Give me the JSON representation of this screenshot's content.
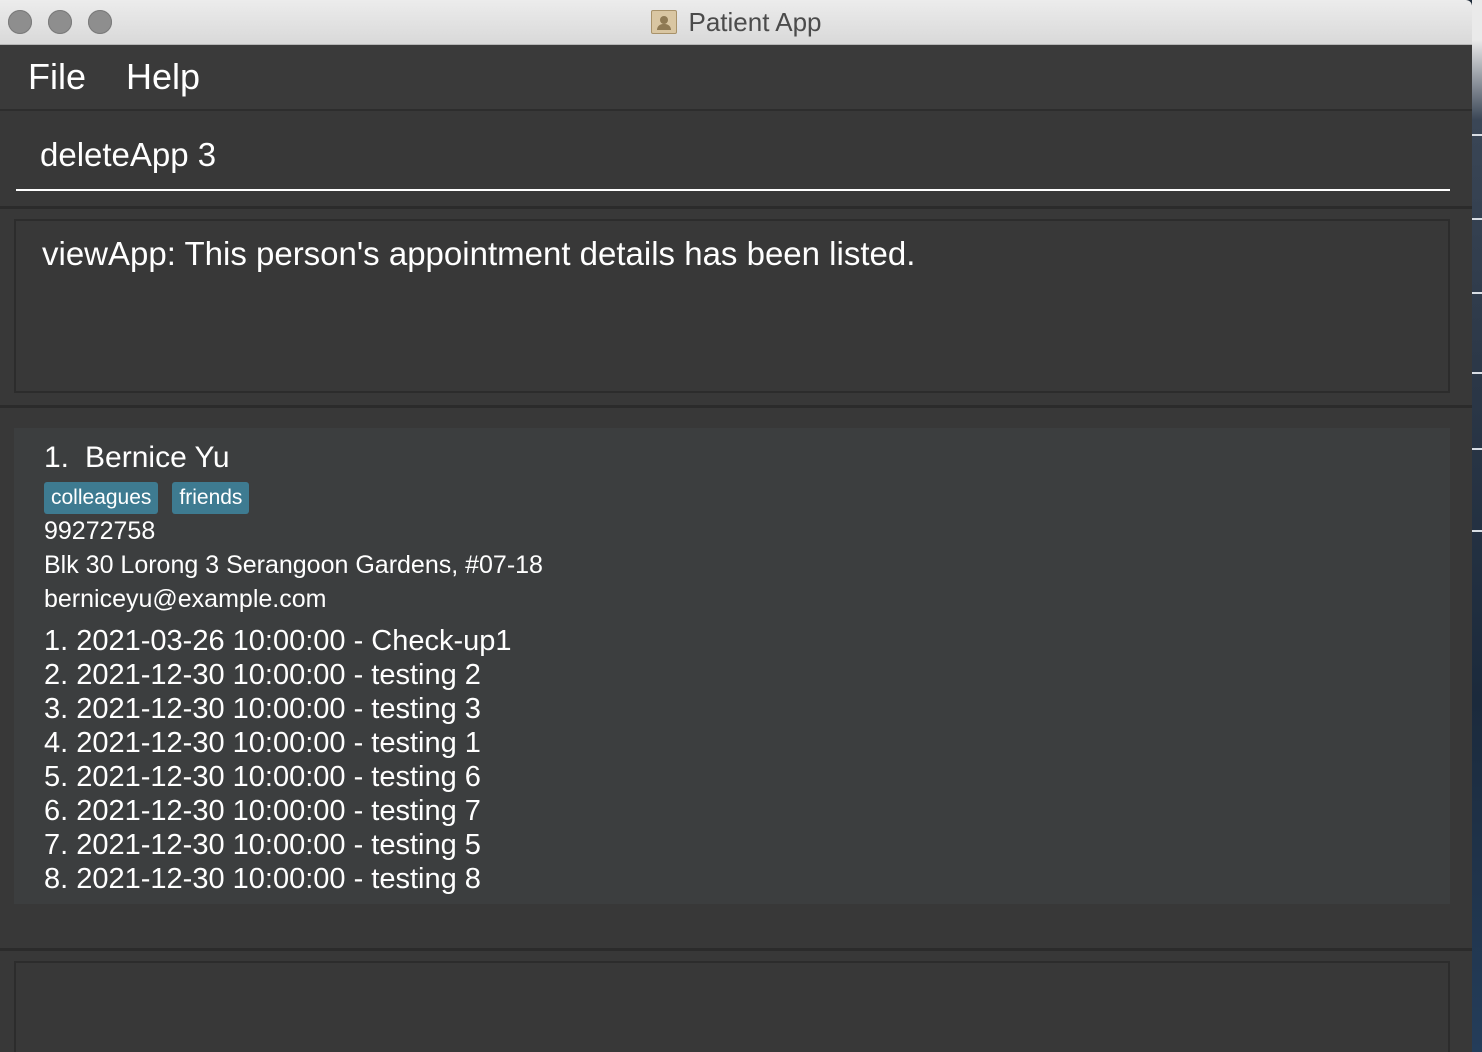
{
  "window": {
    "title": "Patient App"
  },
  "menu": {
    "items": [
      "File",
      "Help"
    ]
  },
  "command": {
    "value": "deleteApp 3"
  },
  "result": {
    "text": "viewApp: This person's appointment details has been listed."
  },
  "persons": [
    {
      "index": "1.",
      "name": "Bernice Yu",
      "tags": [
        "colleagues",
        "friends"
      ],
      "phone": "99272758",
      "address": "Blk 30 Lorong 3 Serangoon Gardens, #07-18",
      "email": "berniceyu@example.com",
      "appointments": [
        "1. 2021-03-26 10:00:00 - Check-up1",
        "2. 2021-12-30 10:00:00 - testing 2",
        "3. 2021-12-30 10:00:00 - testing 3",
        "4. 2021-12-30 10:00:00 - testing 1",
        "5. 2021-12-30 10:00:00 - testing 6",
        "6. 2021-12-30 10:00:00 - testing 7",
        "7. 2021-12-30 10:00:00 - testing 5",
        "8. 2021-12-30 10:00:00 - testing 8"
      ]
    }
  ],
  "colors": {
    "background": "#383838",
    "card": "#3c3e3f",
    "tag": "#3e7b91",
    "text": "#ffffff"
  }
}
